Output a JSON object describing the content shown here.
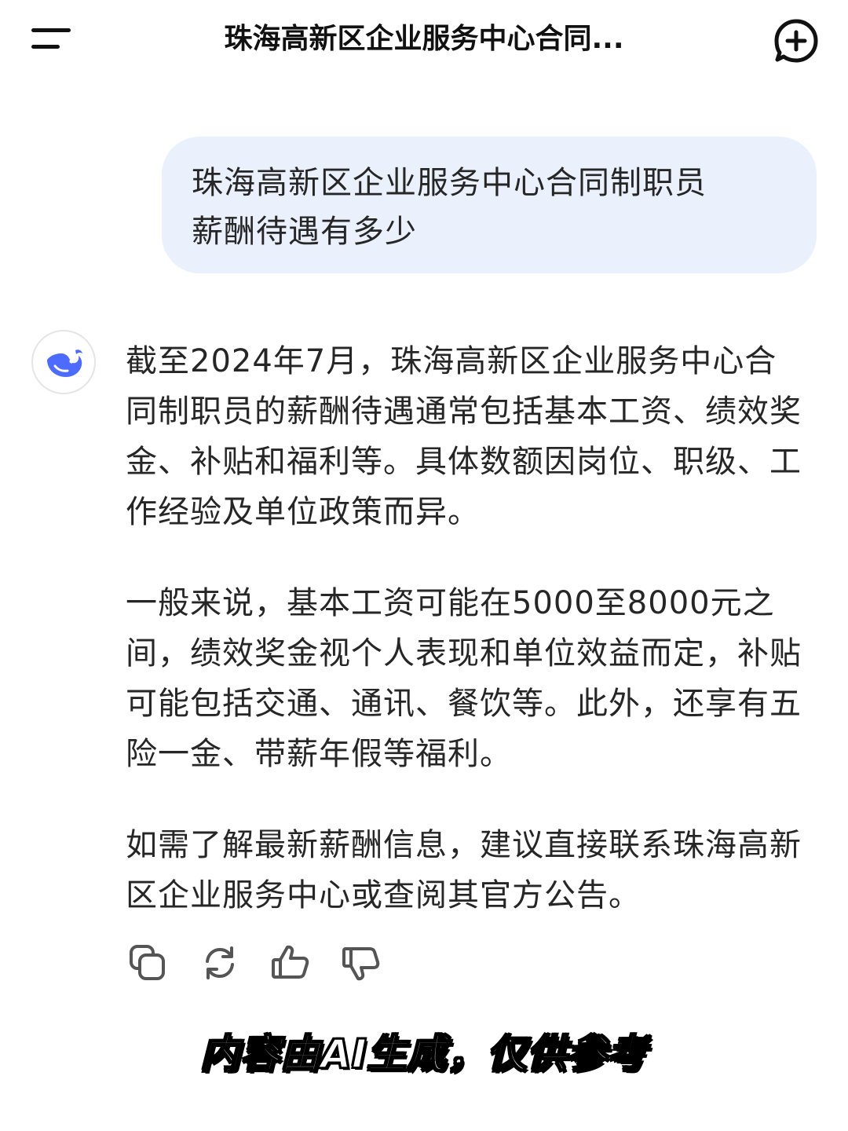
{
  "header": {
    "title": "珠海高新区企业服务中心合同...",
    "menu_icon": "menu-icon",
    "new_chat_icon": "new-chat-icon"
  },
  "user_message": {
    "line1": "珠海高新区企业服务中心合同制职员",
    "line2": "薪酬待遇有多少"
  },
  "assistant": {
    "avatar_icon": "whale-logo-icon",
    "paragraphs": [
      "截至2024年7月，珠海高新区企业服务中心合同制职员的薪酬待遇通常包括基本工资、绩效奖金、补贴和福利等。具体数额因岗位、职级、工作经验及单位政策而异。",
      "一般来说，基本工资可能在5000至8000元之间，绩效奖金视个人表现和单位效益而定，补贴可能包括交通、通讯、餐饮等。此外，还享有五险一金、带薪年假等福利。",
      "如需了解最新薪酬信息，建议直接联系珠海高新区企业服务中心或查阅其官方公告。"
    ],
    "actions": [
      "copy-icon",
      "regenerate-icon",
      "thumbs-up-icon",
      "thumbs-down-icon"
    ]
  },
  "caption": "内容由AI生成，仅供参考",
  "colors": {
    "user_bubble": "#eaf0fc",
    "brand": "#4d6bfe",
    "text": "#262626"
  }
}
